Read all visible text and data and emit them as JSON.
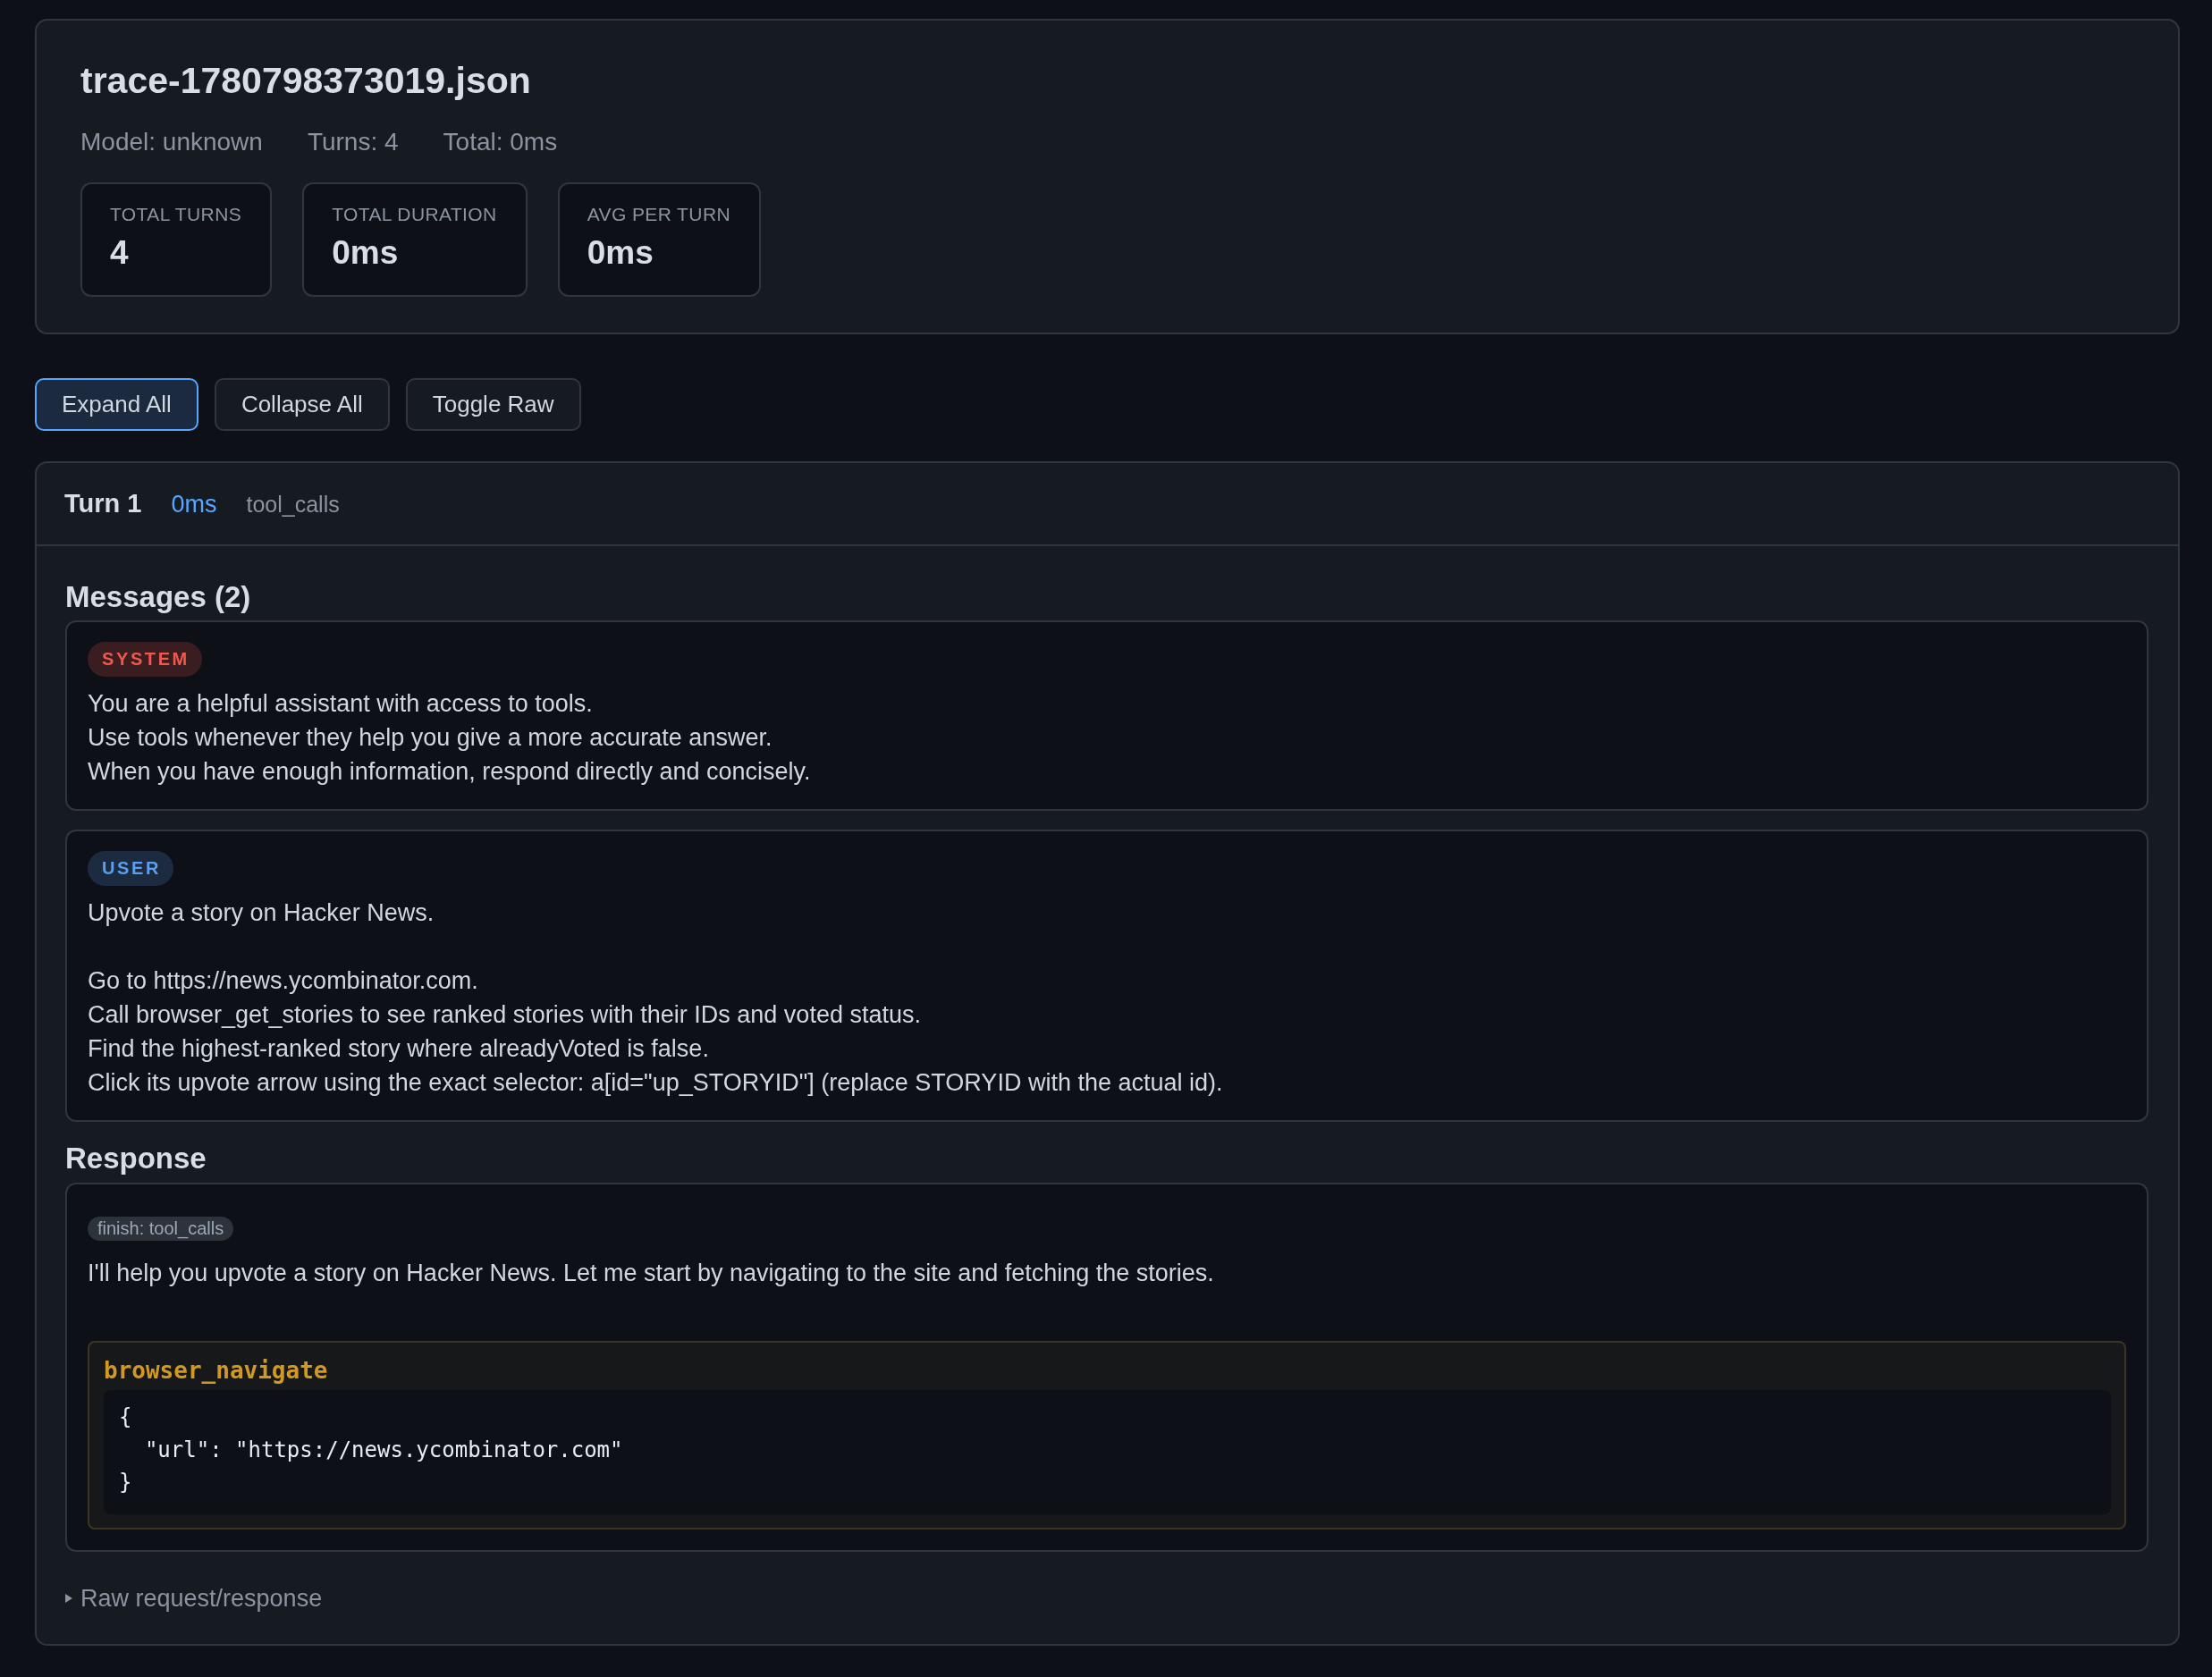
{
  "header": {
    "title": "trace-1780798373019.json",
    "meta": [
      "Model: unknown",
      "Turns: 4",
      "Total: 0ms"
    ],
    "stats": [
      {
        "label": "TOTAL TURNS",
        "value": "4"
      },
      {
        "label": "TOTAL DURATION",
        "value": "0ms"
      },
      {
        "label": "AVG PER TURN",
        "value": "0ms"
      }
    ]
  },
  "toolbar": {
    "buttons": [
      {
        "label": "Expand All",
        "selected": true
      },
      {
        "label": "Collapse All",
        "selected": false
      },
      {
        "label": "Toggle Raw",
        "selected": false
      }
    ]
  },
  "turns": [
    {
      "title": "Turn 1",
      "duration": "0ms",
      "finish_reason": "tool_calls",
      "messages_heading": "Messages (2)",
      "messages": [
        {
          "kind": "system",
          "role": "SYSTEM",
          "text": "You are a helpful assistant with access to tools.\nUse tools whenever they help you give a more accurate answer.\nWhen you have enough information, respond directly and concisely."
        },
        {
          "kind": "user",
          "role": "USER",
          "text": "Upvote a story on Hacker News.\n\nGo to https://news.ycombinator.com.\nCall browser_get_stories to see ranked stories with their IDs and voted status.\nFind the highest-ranked story where alreadyVoted is false.\nClick its upvote arrow using the exact selector: a[id=\"up_STORYID\"] (replace STORYID with the actual id)."
        }
      ],
      "response_heading": "Response",
      "response": {
        "finish_badge": "finish: tool_calls",
        "text": "I'll help you upvote a story on Hacker News. Let me start by navigating to the site and fetching the stories.",
        "tool_calls": [
          {
            "name": "browser_navigate",
            "arguments": "{\n  \"url\": \"https://news.ycombinator.com\"\n}"
          }
        ]
      },
      "raw_toggle": {
        "label": "Raw request/response",
        "expanded": false
      }
    }
  ]
}
